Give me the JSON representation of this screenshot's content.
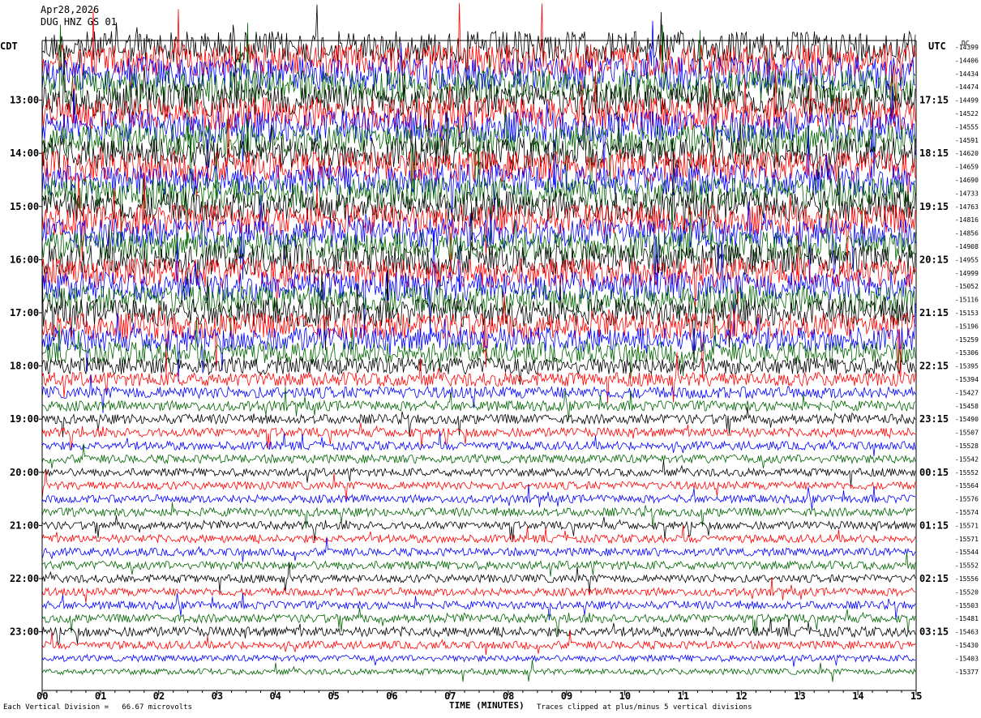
{
  "header": {
    "date": "Apr28,2026",
    "station": "DUG HNZ GS 01"
  },
  "timezones": {
    "left": "CDT",
    "right": "UTC"
  },
  "footer": {
    "scale_note": "Each Vertical Division =   66.67 microvolts",
    "xaxis_title": "TIME (MINUTES)",
    "clip_note": "Traces clipped at plus/minus 5 vertical divisions",
    "dc_label": "DC"
  },
  "chart_data": {
    "type": "line",
    "title": "",
    "xlabel": "TIME (MINUTES)",
    "xlim": [
      0,
      15
    ],
    "x_ticks": [
      "00",
      "01",
      "02",
      "03",
      "04",
      "05",
      "06",
      "07",
      "08",
      "09",
      "10",
      "11",
      "12",
      "13",
      "14",
      "15"
    ],
    "trace_interval_minutes": 15,
    "trace_count": 48,
    "trace_colors": [
      "#000000",
      "#ff0000",
      "#0000ff",
      "#006400"
    ],
    "left_hour_labels": [
      "13:00",
      "14:00",
      "15:00",
      "16:00",
      "17:00",
      "18:00",
      "19:00",
      "20:00",
      "21:00",
      "22:00",
      "23:00"
    ],
    "right_hour_labels": [
      "17:15",
      "18:15",
      "19:15",
      "20:15",
      "21:15",
      "22:15",
      "23:15",
      "00:15",
      "01:15",
      "02:15",
      "03:15"
    ],
    "dc_offsets": [
      "-14399",
      "-14406",
      "-14434",
      "-14474",
      "-14499",
      "-14522",
      "-14555",
      "-14591",
      "-14620",
      "-14659",
      "-14690",
      "-14733",
      "-14763",
      "-14816",
      "-14856",
      "-14908",
      "-14955",
      "-14999",
      "-15052",
      "-15116",
      "-15153",
      "-15196",
      "-15259",
      "-15306",
      "-15395",
      "-15394",
      "-15427",
      "-15458",
      "-15490",
      "-15507",
      "-15528",
      "-15542",
      "-15552",
      "-15564",
      "-15576",
      "-15574",
      "-15571",
      "-15571",
      "-15544",
      "-15552",
      "-15556",
      "-15520",
      "-15503",
      "-15481",
      "-15463",
      "-15430",
      "-15403",
      "-15377"
    ],
    "trace_noise_level": [
      6.0,
      6.1,
      6.2,
      6.3,
      6.2,
      6.1,
      6.0,
      6.0,
      5.9,
      5.8,
      5.8,
      5.9,
      5.8,
      5.7,
      5.6,
      5.5,
      5.7,
      5.6,
      5.4,
      5.3,
      5.2,
      5.0,
      4.6,
      4.0,
      3.2,
      2.6,
      2.2,
      1.9,
      1.8,
      1.7,
      1.6,
      1.6,
      1.5,
      1.5,
      1.5,
      1.6,
      1.5,
      1.5,
      1.5,
      1.6,
      1.5,
      1.5,
      1.5,
      1.6,
      1.8,
      1.5,
      1.2,
      1.1
    ]
  }
}
